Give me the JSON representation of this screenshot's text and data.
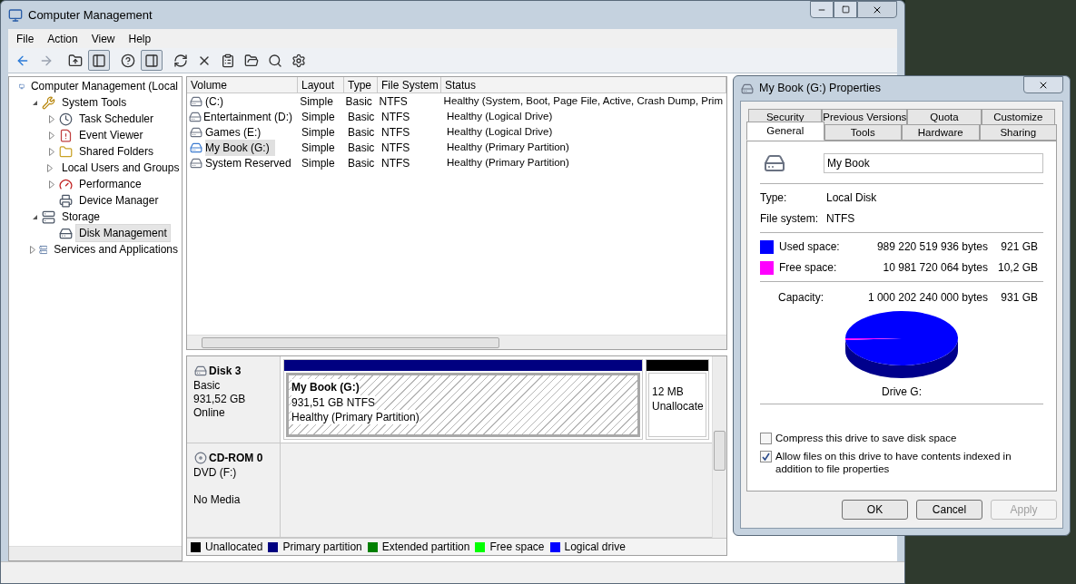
{
  "window": {
    "title": "Computer Management"
  },
  "menu": [
    "File",
    "Action",
    "View",
    "Help"
  ],
  "toolbar": [
    {
      "pressed": false,
      "disabled": false
    },
    {
      "pressed": false,
      "disabled": true
    },
    {
      "pressed": false,
      "disabled": false
    },
    {
      "pressed": true,
      "disabled": false
    },
    {
      "pressed": false,
      "disabled": false
    },
    {
      "pressed": true,
      "disabled": false
    },
    {
      "pressed": false,
      "disabled": false
    },
    {
      "pressed": false,
      "disabled": false
    },
    {
      "pressed": false,
      "disabled": false
    },
    {
      "pressed": false,
      "disabled": false
    },
    {
      "pressed": false,
      "disabled": false
    },
    {
      "pressed": false,
      "disabled": false
    }
  ],
  "tree": [
    {
      "label": "Computer Management (Local",
      "kind": "computer",
      "selected": false,
      "children": [
        {
          "label": "System Tools",
          "kind": "tools",
          "expanded": true,
          "selected": false,
          "children": [
            {
              "label": "Task Scheduler",
              "kind": "clock",
              "expanded": false,
              "selected": false
            },
            {
              "label": "Event Viewer",
              "kind": "log",
              "expanded": false,
              "selected": false
            },
            {
              "label": "Shared Folders",
              "kind": "folder",
              "expanded": false,
              "selected": false
            },
            {
              "label": "Local Users and Groups",
              "kind": "users",
              "expanded": false,
              "selected": false
            },
            {
              "label": "Performance",
              "kind": "gauge",
              "expanded": false,
              "selected": false
            },
            {
              "label": "Device Manager",
              "kind": "device",
              "selected": false
            }
          ]
        },
        {
          "label": "Storage",
          "kind": "storage",
          "expanded": true,
          "selected": false,
          "children": [
            {
              "label": "Disk Management",
              "kind": "disk",
              "selected": true
            }
          ]
        },
        {
          "label": "Services and Applications",
          "kind": "services",
          "expanded": false,
          "selected": false
        }
      ]
    }
  ],
  "volumes": {
    "columns": [
      "Volume",
      "Layout",
      "Type",
      "File System",
      "Status"
    ],
    "rows": [
      {
        "cells": [
          " (C:)",
          "Simple",
          "Basic",
          "NTFS",
          "Healthy (System, Boot, Page File, Active, Crash Dump, Prim"
        ],
        "selected": false,
        "kind": "local"
      },
      {
        "cells": [
          "Entertainment (D:)",
          "Simple",
          "Basic",
          "NTFS",
          "Healthy (Logical Drive)"
        ],
        "selected": false,
        "kind": "local"
      },
      {
        "cells": [
          "Games (E:)",
          "Simple",
          "Basic",
          "NTFS",
          "Healthy (Logical Drive)"
        ],
        "selected": false,
        "kind": "local"
      },
      {
        "cells": [
          "My Book (G:)",
          "Simple",
          "Basic",
          "NTFS",
          "Healthy (Primary Partition)"
        ],
        "selected": true,
        "kind": "external"
      },
      {
        "cells": [
          "System Reserved",
          "Simple",
          "Basic",
          "NTFS",
          "Healthy (Primary Partition)"
        ],
        "selected": false,
        "kind": "local"
      }
    ]
  },
  "disks": [
    {
      "name": "Disk 3",
      "kind": "disk",
      "type": "Basic",
      "size": "931,52 GB",
      "status": "Online",
      "partitions": [
        {
          "kind": "primary",
          "title": "My Book  (G:)",
          "lines": [
            "931,51 GB NTFS",
            "Healthy (Primary Partition)"
          ],
          "selected": true
        },
        {
          "kind": "unallocated",
          "lines": [
            "12 MB",
            "Unallocate"
          ],
          "selected": false
        }
      ]
    },
    {
      "name": "CD-ROM 0",
      "kind": "cdrom",
      "type": "DVD (F:)",
      "status": "No Media"
    }
  ],
  "legend": [
    {
      "label": "Unallocated",
      "kind": "unallocated",
      "color": "#000000"
    },
    {
      "label": "Primary partition",
      "kind": "primary",
      "color": "#000080"
    },
    {
      "label": "Extended partition",
      "kind": "extended",
      "color": "#008000"
    },
    {
      "label": "Free space",
      "kind": "free",
      "color": "#00ff00"
    },
    {
      "label": "Logical drive",
      "kind": "logical",
      "color": "#0000ff"
    }
  ],
  "dialog": {
    "title": "My Book (G:) Properties",
    "tab_rows": [
      [
        {
          "label": "Security",
          "selected": false
        },
        {
          "label": "Previous Versions",
          "selected": false
        },
        {
          "label": "Quota",
          "selected": false
        },
        {
          "label": "Customize",
          "selected": false
        }
      ],
      [
        {
          "label": "General",
          "selected": true
        },
        {
          "label": "Tools",
          "selected": false
        },
        {
          "label": "Hardware",
          "selected": false
        },
        {
          "label": "Sharing",
          "selected": false
        }
      ]
    ],
    "name_field": "My Book",
    "info": [
      {
        "label": "Type:",
        "value": "Local Disk"
      },
      {
        "label": "File system:",
        "value": "NTFS"
      }
    ],
    "usage": [
      {
        "label": "Used space:",
        "bytes": "989 220 519 936 bytes",
        "size": "921 GB",
        "color": "#0000ff"
      },
      {
        "label": "Free space:",
        "bytes": "10 981 720 064 bytes",
        "size": "10,2 GB",
        "color": "#ff00ff"
      }
    ],
    "capacity": {
      "label": "Capacity:",
      "bytes": "1 000 202 240 000 bytes",
      "size": "931 GB"
    },
    "pie": {
      "level": 0.989
    },
    "drive_label": "Drive G:",
    "checkboxes": [
      {
        "label": "Compress this drive to save disk space",
        "checked": false
      },
      {
        "label": "Allow files on this drive to have contents indexed in addition to file properties",
        "checked": true
      }
    ],
    "buttons": [
      {
        "label": "OK",
        "disabled": false
      },
      {
        "label": "Cancel",
        "disabled": false
      },
      {
        "label": "Apply",
        "disabled": true
      }
    ]
  }
}
